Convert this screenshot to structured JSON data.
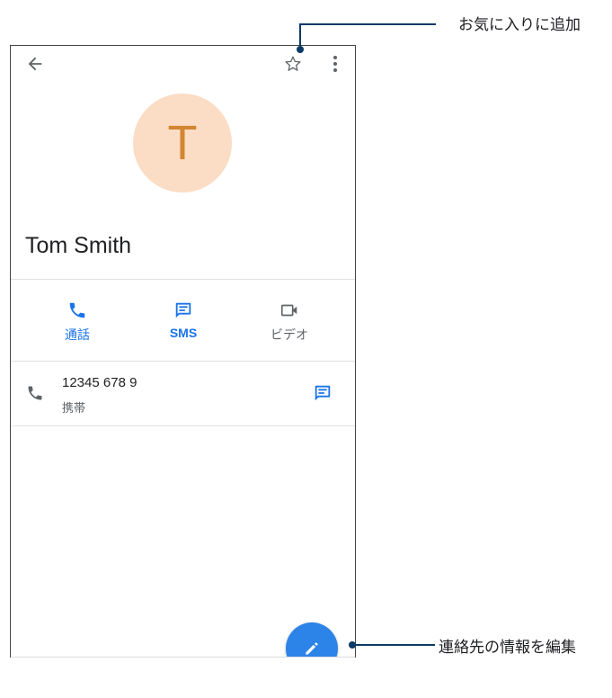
{
  "contact": {
    "initial": "T",
    "name": "Tom Smith"
  },
  "actions": {
    "call_label": "通話",
    "sms_label": "SMS",
    "video_label": "ビデオ"
  },
  "phone_entry": {
    "number": "12345 678 9",
    "type": "携帯"
  },
  "callouts": {
    "favorite": "お気に入りに追加",
    "edit": "連絡先の情報を編集"
  },
  "icons": {
    "back": "arrow-back-icon",
    "star": "star-outline-icon",
    "more": "more-vert-icon",
    "call": "phone-icon",
    "sms": "message-icon",
    "video": "videocam-icon",
    "edit": "pencil-icon"
  },
  "colors": {
    "accent": "#1a73e8",
    "avatar_bg": "#fbdcc4",
    "avatar_text": "#d28630",
    "fab": "#2c83e8",
    "callout_line": "#0b3a66"
  }
}
